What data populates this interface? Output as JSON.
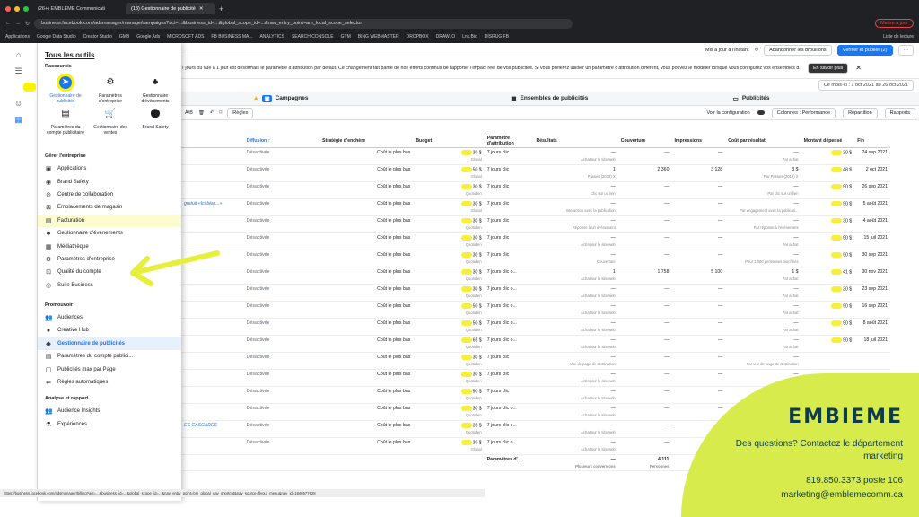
{
  "browser": {
    "tab1": "(26+) EMBLEME Communicati",
    "tab2": "(18) Gestionnaire de publicité",
    "url": "business.facebook.com/adsmanager/manage/campaigns?act=...&business_id=...&global_scope_id=...&nav_entry_point=am_local_scope_selector",
    "mettre": "Mettre à jour",
    "bookmarks": [
      "Applications",
      "Google Data Studio",
      "Creator Studio",
      "GMB",
      "Google Ads",
      "MICROSOFT ADS",
      "FB BUSINESS MA...",
      "ANALYTICS",
      "SEARCH CONSOLE",
      "GTM",
      "BING WEBMASTER",
      "DROPBOX",
      "DRAW.IO",
      "Lnk.Bio",
      "DISRUG FB"
    ],
    "reading": "Liste de lecture"
  },
  "panel": {
    "title": "Tous les outils",
    "shortcuts_title": "Raccourcis",
    "shortcuts": [
      {
        "label": "Gestionnaire de publicités",
        "icon": "navigation-icon"
      },
      {
        "label": "Paramètres d'entreprise",
        "icon": "gear-icon"
      },
      {
        "label": "Gestionnaire d'événements",
        "icon": "people-icon"
      },
      {
        "label": "Paramètres du compte publicitaire",
        "icon": "card-icon"
      },
      {
        "label": "Gestionnaire des ventes",
        "icon": "cart-icon"
      },
      {
        "label": "Brand Safety",
        "icon": "shield-icon"
      }
    ],
    "section_manage": "Gérer l'entreprise",
    "manage": [
      "Applications",
      "Brand Safety",
      "Centre de collaboration",
      "Emplacements de magasin",
      "Facturation",
      "Gestionnaire d'événements",
      "Médiathèque",
      "Paramètres d'entreprise",
      "Qualité du compte",
      "Suite Business"
    ],
    "section_promote": "Promouvoir",
    "promote": [
      "Audiences",
      "Creative Hub",
      "Gestionnaire de publicités",
      "Paramètres du compte publici...",
      "Publicités max par Page",
      "Règles automatiques"
    ],
    "section_analyze": "Analyse et rapport",
    "analyze": [
      "Audience Insights",
      "Expériences"
    ]
  },
  "topbar": {
    "updated": "Mis à jour à l'instant",
    "discard": "Abandonner les brouillons",
    "publish": "Vérifier et publier (2)",
    "more": "···"
  },
  "banner": {
    "text": "7 jours ou vue à 1 jour est désormais le paramètre d'attribution par défaut. Ce changement fait partie de nos efforts continus de rapporter l'impact réel de vos publicités. Si vous préférez utiliser un paramètre d'attribution différent, vous pouvez le modifier lorsque vous configurez vos ensembles d...",
    "more": "En savoir plus"
  },
  "daterange": "Ce mois-ci : 1 oct 2021 au 26 oct 2021",
  "levels": {
    "campaigns": "Campagnes",
    "adsets": "Ensembles de publicités",
    "ads": "Publicités"
  },
  "toolbar": {
    "ab": "A/B",
    "rules": "Règles",
    "config": "Voir la configuration",
    "columns": "Colonnes : Performance",
    "breakdown": "Répartition",
    "reports": "Rapports"
  },
  "columns": [
    "Diffusion ↑",
    "Stratégie d'enchère",
    "Budget",
    "Paramètre d'attribution",
    "Résultats",
    "Couverture",
    "Impressions",
    "Coût par résultat",
    "Montant dépensé",
    "Fin"
  ],
  "rows": [
    {
      "name": "",
      "diff": "Désactivée",
      "bid": "Coût le plus bas",
      "budget": "30 $",
      "bsub": "Global",
      "attr": "7 jours clic",
      "res": "—",
      "rsub": "Achat sur le site web",
      "reach": "—",
      "imp": "—",
      "cpr": "—",
      "csub": "Par achat",
      "spent": "30 $",
      "end": "24 sep 2021"
    },
    {
      "name": "",
      "diff": "Désactivée",
      "bid": "Coût le plus bas",
      "budget": "50 $",
      "bsub": "Global",
      "attr": "7 jours clic",
      "res": "1",
      "rsub": "Passes (2019) X",
      "reach": "2 360",
      "imp": "3 128",
      "cpr": "3 $",
      "csub": "Par Passes (2019) X",
      "spent": "48 $",
      "end": "2 oct 2021"
    },
    {
      "name": "",
      "diff": "Désactivée",
      "bid": "Coût le plus bas",
      "budget": "30 $",
      "bsub": "Quotidien",
      "attr": "7 jours clic",
      "res": "—",
      "rsub": "Clic sur un lien",
      "reach": "—",
      "imp": "—",
      "cpr": "—",
      "csub": "Par clic sur un lien",
      "spent": "90 $",
      "end": "26 sep 2021"
    },
    {
      "name": "gratuit «Ici bien...»",
      "diff": "Désactivée",
      "bid": "Coût le plus bas",
      "budget": "30 $",
      "bsub": "Global",
      "attr": "7 jours clic",
      "res": "—",
      "rsub": "Interaction avec la publication",
      "reach": "—",
      "imp": "—",
      "cpr": "—",
      "csub": "Par engagement avec la publicati...",
      "spent": "90 $",
      "end": "5 août 2021"
    },
    {
      "name": "",
      "diff": "Désactivée",
      "bid": "Coût le plus bas",
      "budget": "30 $",
      "bsub": "Quotidien",
      "attr": "7 jours clic",
      "res": "—",
      "rsub": "Réponse à un événement",
      "reach": "—",
      "imp": "—",
      "cpr": "—",
      "csub": "Par réponse à l'événement",
      "spent": "30 $",
      "end": "4 août 2021"
    },
    {
      "name": "",
      "diff": "Désactivée",
      "bid": "Coût le plus bas",
      "budget": "30 $",
      "bsub": "Quotidien",
      "attr": "7 jours clic",
      "res": "—",
      "rsub": "Achat sur le site web",
      "reach": "—",
      "imp": "—",
      "cpr": "—",
      "csub": "Par achat",
      "spent": "90 $",
      "end": "15 juil 2021"
    },
    {
      "name": "",
      "diff": "Désactivée",
      "bid": "Coût le plus bas",
      "budget": "30 $",
      "bsub": "Quotidien",
      "attr": "7 jours clic",
      "res": "—",
      "rsub": "Couverture",
      "reach": "—",
      "imp": "—",
      "cpr": "—",
      "csub": "Pour 1 000 personnes touchées",
      "spent": "90 $",
      "end": "30 sep 2021"
    },
    {
      "name": "",
      "diff": "Désactivée",
      "bid": "Coût le plus bas",
      "budget": "30 $",
      "bsub": "Quotidien",
      "attr": "7 jours clic o...",
      "res": "1",
      "rsub": "Achat sur le site web",
      "reach": "1 758",
      "imp": "5 100",
      "cpr": "1 $",
      "csub": "Par achat",
      "spent": "41 $",
      "end": "30 nov 2021"
    },
    {
      "name": "",
      "diff": "Désactivée",
      "bid": "Coût le plus bas",
      "budget": "30 $",
      "bsub": "Quotidien",
      "attr": "7 jours clic o...",
      "res": "—",
      "rsub": "Achat sur le site web",
      "reach": "—",
      "imp": "—",
      "cpr": "—",
      "csub": "Par achat",
      "spent": "30 $",
      "end": "23 sep 2021"
    },
    {
      "name": "",
      "diff": "Désactivée",
      "bid": "Coût le plus bas",
      "budget": "50 $",
      "bsub": "Quotidien",
      "attr": "7 jours clic o...",
      "res": "—",
      "rsub": "Achat sur le site web",
      "reach": "—",
      "imp": "—",
      "cpr": "—",
      "csub": "Par achat",
      "spent": "90 $",
      "end": "16 sep 2021"
    },
    {
      "name": "",
      "diff": "Désactivée",
      "bid": "Coût le plus bas",
      "budget": "50 $",
      "bsub": "Quotidien",
      "attr": "7 jours clic o...",
      "res": "—",
      "rsub": "Achat sur le site web",
      "reach": "—",
      "imp": "—",
      "cpr": "—",
      "csub": "Par achat",
      "spent": "90 $",
      "end": "8 août 2021"
    },
    {
      "name": "",
      "diff": "Désactivée",
      "bid": "Coût le plus bas",
      "budget": "65 $",
      "bsub": "Quotidien",
      "attr": "7 jours clic o...",
      "res": "—",
      "rsub": "Achat sur le site web",
      "reach": "—",
      "imp": "—",
      "cpr": "—",
      "csub": "Par achat",
      "spent": "90 $",
      "end": "18 juil 2021"
    },
    {
      "name": "",
      "diff": "Désactivée",
      "bid": "Coût le plus bas",
      "budget": "30 $",
      "bsub": "Quotidien",
      "attr": "7 jours clic",
      "res": "—",
      "rsub": "Vue de page de destination",
      "reach": "—",
      "imp": "—",
      "cpr": "—",
      "csub": "Par vue de page de destination",
      "spent": "",
      "end": ""
    },
    {
      "name": "",
      "diff": "Désactivée",
      "bid": "Coût le plus bas",
      "budget": "30 $",
      "bsub": "Quotidien",
      "attr": "7 jours clic",
      "res": "—",
      "rsub": "Achat sur le site web",
      "reach": "—",
      "imp": "—",
      "cpr": "—",
      "csub": "",
      "spent": "",
      "end": ""
    },
    {
      "name": "",
      "diff": "Désactivée",
      "bid": "Coût le plus bas",
      "budget": "90 $",
      "bsub": "Quotidien",
      "attr": "7 jours clic",
      "res": "—",
      "rsub": "Achat sur le site web",
      "reach": "—",
      "imp": "—",
      "cpr": "",
      "csub": "",
      "spent": "",
      "end": ""
    },
    {
      "name": "",
      "diff": "Désactivée",
      "bid": "Coût le plus bas",
      "budget": "30 $",
      "bsub": "Quotidien",
      "attr": "7 jours clic o...",
      "res": "—",
      "rsub": "Achat sur le site web",
      "reach": "—",
      "imp": "—",
      "cpr": "",
      "csub": "",
      "spent": "",
      "end": ""
    },
    {
      "name": "ES CASCADES",
      "diff": "Désactivée",
      "bid": "Coût le plus bas",
      "budget": "35 $",
      "bsub": "Quotidien",
      "attr": "7 jours clic o...",
      "res": "—",
      "rsub": "Achat sur le site web",
      "reach": "—",
      "imp": "—",
      "cpr": "",
      "csub": "",
      "spent": "",
      "end": ""
    },
    {
      "name": "",
      "diff": "Désactivée",
      "bid": "Coût le plus bas",
      "budget": "30 $",
      "bsub": "Global",
      "attr": "7 jours clic o...",
      "res": "—",
      "rsub": "Achat sur le site web",
      "reach": "—",
      "imp": "—",
      "cpr": "",
      "csub": "",
      "spent": "",
      "end": ""
    }
  ],
  "totals": {
    "label": "Paramètres d'...",
    "res": "—",
    "rsub": "Plusieurs conversions",
    "reach": "4 111",
    "rsub2": "Personnes",
    "imp": "8 228",
    "isub": "Total"
  },
  "statusbar": "https://business.facebook.com/adsmanager/billing?act=...&business_id=...&global_scope_id=...&nav_entry_point=bm_global_nav_shortcut&nav_source=flyout_menu&nav_id=1846577628",
  "brand": {
    "logo": "EMBIEME",
    "question": "Des questions? Contactez le département marketing",
    "phone": "819.850.3373 poste 106",
    "email": "marketing@emblemecomm.ca"
  }
}
